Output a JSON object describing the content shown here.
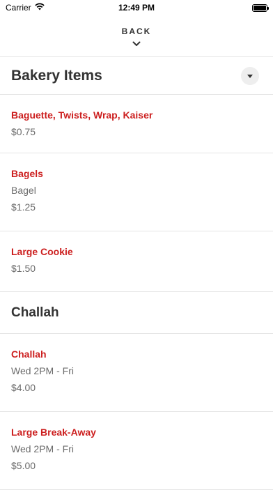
{
  "status_bar": {
    "carrier": "Carrier",
    "time": "12:49 PM"
  },
  "nav": {
    "back_label": "BACK"
  },
  "sections": [
    {
      "title": "Bakery Items",
      "items": [
        {
          "name": "Baguette, Twists, Wrap, Kaiser",
          "price": "$0.75"
        },
        {
          "name": "Bagels",
          "description": "Bagel",
          "price": "$1.25"
        },
        {
          "name": "Large Cookie",
          "price": "$1.50"
        }
      ]
    },
    {
      "title": "Challah",
      "items": [
        {
          "name": "Challah",
          "description": "Wed 2PM - Fri",
          "price": "$4.00"
        },
        {
          "name": "Large Break-Away",
          "description": "Wed 2PM - Fri",
          "price": "$5.00"
        }
      ]
    }
  ]
}
